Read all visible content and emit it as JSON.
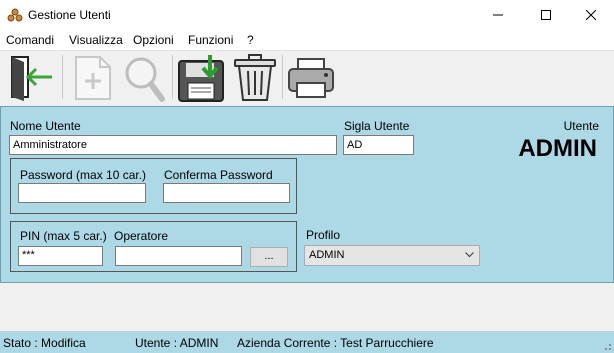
{
  "window": {
    "title": "Gestione Utenti"
  },
  "menu": [
    "Comandi",
    "Visualizza",
    "Opzioni",
    "Funzioni",
    "?"
  ],
  "toolbar": {
    "items": [
      "exit-icon",
      "new-document-icon",
      "search-icon",
      "save-icon",
      "trash-icon",
      "printer-icon"
    ],
    "disabled": [
      "new-document-icon",
      "search-icon"
    ]
  },
  "form": {
    "nome_utente_label": "Nome Utente",
    "nome_utente_value": "Amministratore",
    "sigla_label": "Sigla Utente",
    "sigla_value": "AD",
    "utente_caption": "Utente",
    "utente_big": "ADMIN",
    "password_label": "Password (max 10 car.)",
    "password_value": "",
    "conferma_label": "Conferma Password",
    "conferma_value": "",
    "pin_label": "PIN (max 5 car.)",
    "pin_value": "***",
    "operatore_label": "Operatore",
    "operatore_value": "",
    "browse_label": "...",
    "profilo_label": "Profilo",
    "profilo_value": "ADMIN"
  },
  "status": {
    "stato": "Stato : Modifica",
    "utente": "Utente : ADMIN",
    "azienda": "Azienda Corrente : Test Parrucchiere"
  },
  "colors": {
    "panel": "#add8e6",
    "save_arrow": "#2e9b2e",
    "exit_arrow": "#3aa43a"
  }
}
